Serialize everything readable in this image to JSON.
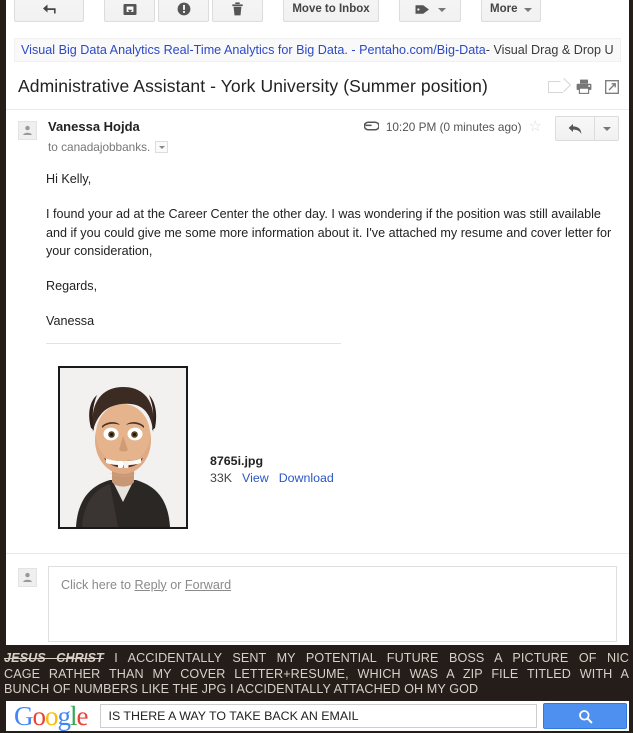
{
  "toolbar": {
    "buttons": [
      {
        "name": "back-button",
        "icon": "back-arrow-icon",
        "label": ""
      },
      {
        "name": "archive-button",
        "icon": "archive-icon",
        "label": ""
      },
      {
        "name": "report-spam-button",
        "icon": "exclamation-circle-icon",
        "label": ""
      },
      {
        "name": "delete-button",
        "icon": "trash-icon",
        "label": ""
      },
      {
        "name": "move-to-inbox-button",
        "icon": "",
        "label": "Move to Inbox"
      },
      {
        "name": "labels-button",
        "icon": "tag-icon",
        "label": ""
      },
      {
        "name": "more-button",
        "icon": "",
        "label": "More"
      }
    ],
    "move_to_inbox_label": "Move to Inbox",
    "more_label": "More"
  },
  "ad": {
    "link_text": "Visual Big Data Analytics Real-Time Analytics for Big Data. - Pentaho.com/Big-Data",
    "tail_text": " - Visual Drag & Drop U"
  },
  "email": {
    "subject": "Administrative Assistant - York University (Summer position)",
    "sender": "Vanessa Hojda",
    "recipient": "to canadajobbanks.",
    "timestamp": "10:20 PM (0 minutes ago)",
    "body": {
      "greeting": "Hi Kelly,",
      "paragraph": "I found your ad at the Career Center the other day. I was wondering if the position was still available and if you could give me some more information about it. I've attached my resume and cover letter for your consideration,",
      "signoff": "Regards,",
      "signature": "Vanessa"
    },
    "attachment": {
      "filename": "8765i.jpg",
      "size": "33K",
      "view_label": "View",
      "download_label": "Download",
      "thumbnail_alt": "nicolas-cage-photo"
    },
    "reply_prompt": {
      "prefix": "Click here to ",
      "reply_label": "Reply",
      "middle": " or ",
      "forward_label": "Forward"
    }
  },
  "caption": {
    "strike_text": "JESUS CHRIST",
    "line1_rest": " I ACCIDENTALLY SENT MY POTENTIAL FUTURE BOSS A PICTURE OF NIC",
    "line2": "CAGE RATHER THAN MY COVER LETTER+RESUME, WHICH WAS A ZIP FILE TITLED WITH A",
    "line3": "BUNCH OF NUMBERS LIKE THE JPG I ACCIDENTALLY ATTACHED OH MY GOD"
  },
  "google": {
    "logo_letters": [
      "G",
      "o",
      "o",
      "g",
      "l",
      "e"
    ],
    "query": "IS THERE A WAY TO TAKE BACK AN EMAIL",
    "search_icon": "magnifier-icon"
  },
  "colors": {
    "link_blue": "#2c49c6",
    "google_blue": "#4285f4",
    "google_red": "#ea4335",
    "google_yellow": "#fbbc05",
    "google_green": "#34a853",
    "caption_bg": "#241d19",
    "caption_fg": "#d9cfc7",
    "search_button": "#4d90f0"
  }
}
